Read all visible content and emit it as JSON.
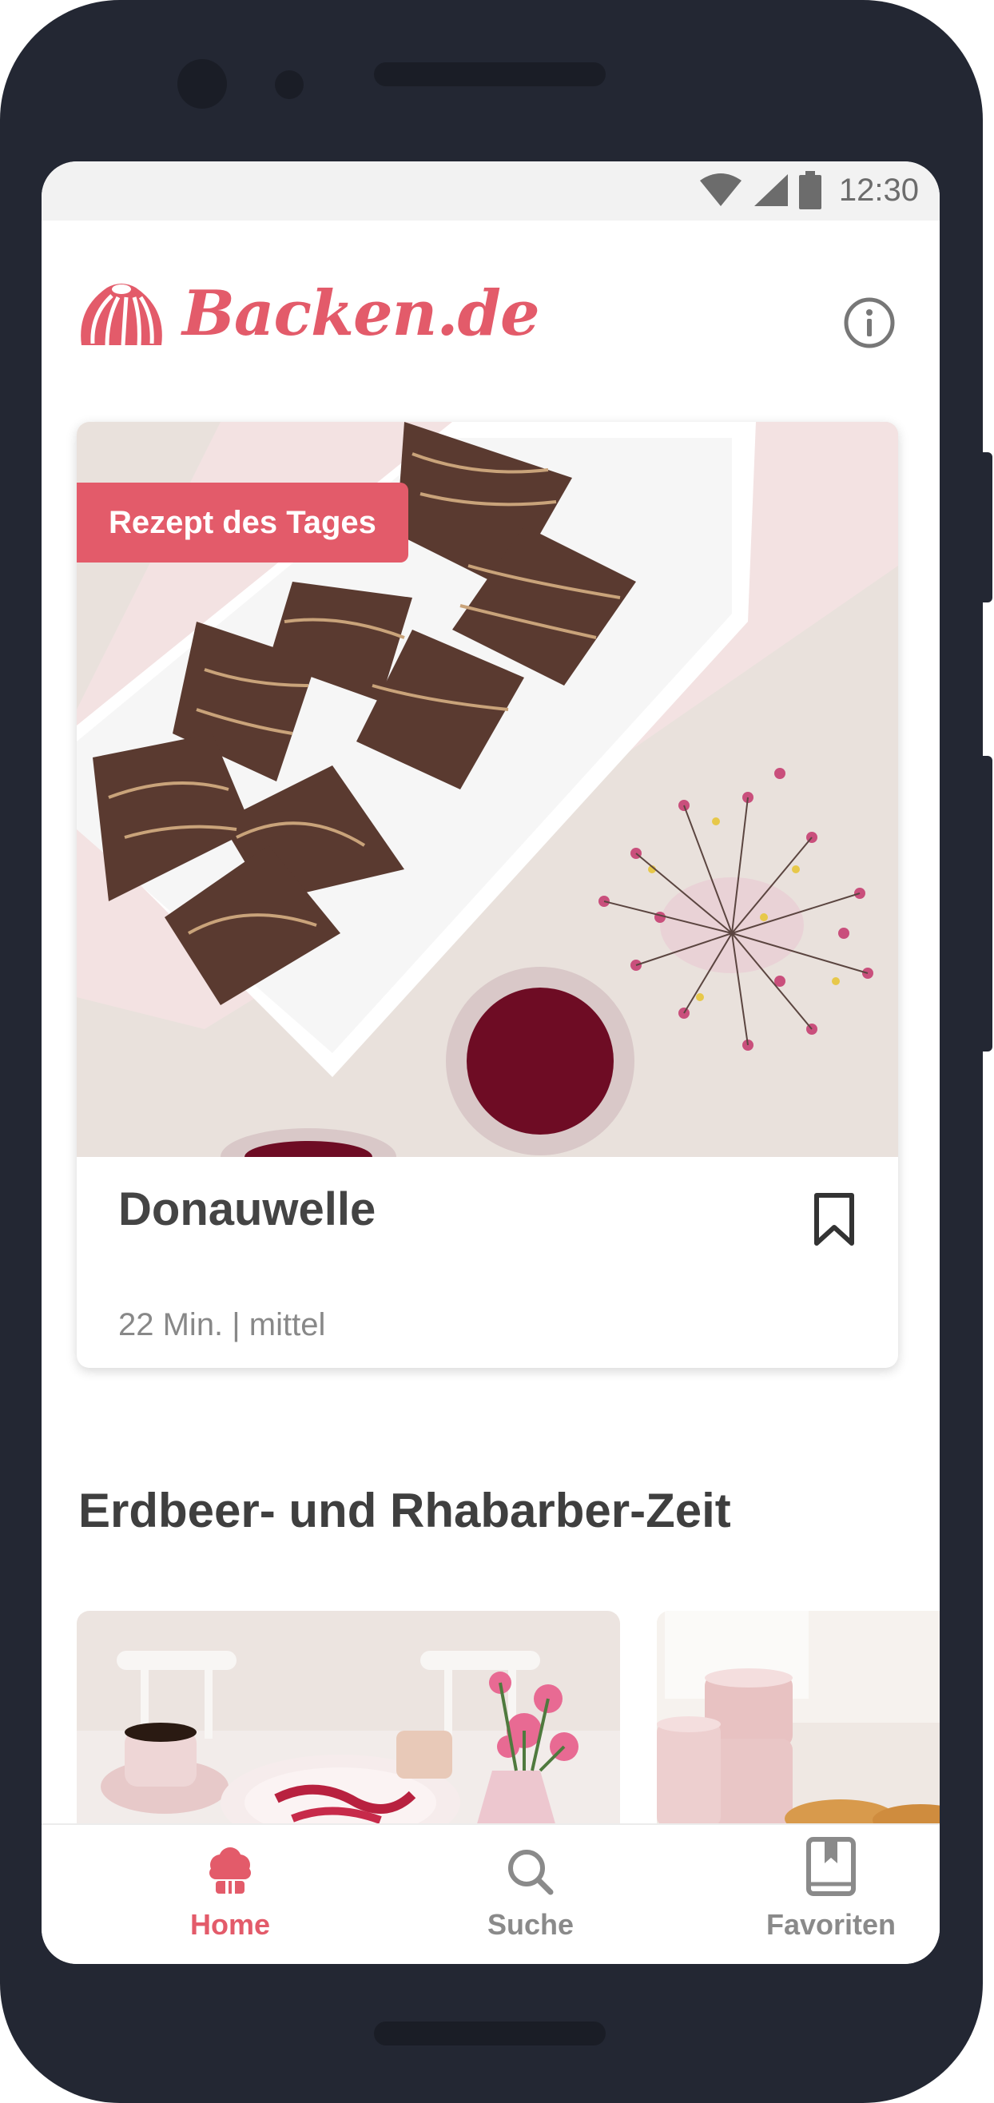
{
  "status_bar": {
    "time": "12:30"
  },
  "header": {
    "logo_text": "Backen.de"
  },
  "featured": {
    "badge": "Rezept des Tages",
    "title": "Donauwelle",
    "meta": "22 Min. | mittel"
  },
  "section": {
    "title": "Erdbeer- und Rhabarber-Zeit"
  },
  "bottom_nav": {
    "items": [
      {
        "label": "Home",
        "icon": "cake-icon",
        "active": true
      },
      {
        "label": "Suche",
        "icon": "search-icon",
        "active": false
      },
      {
        "label": "Favoriten",
        "icon": "book-bookmark-icon",
        "active": false
      }
    ]
  },
  "colors": {
    "brand": "#e35b6a",
    "frame": "#232733",
    "text_dark": "#444444",
    "text_muted": "#888888"
  }
}
